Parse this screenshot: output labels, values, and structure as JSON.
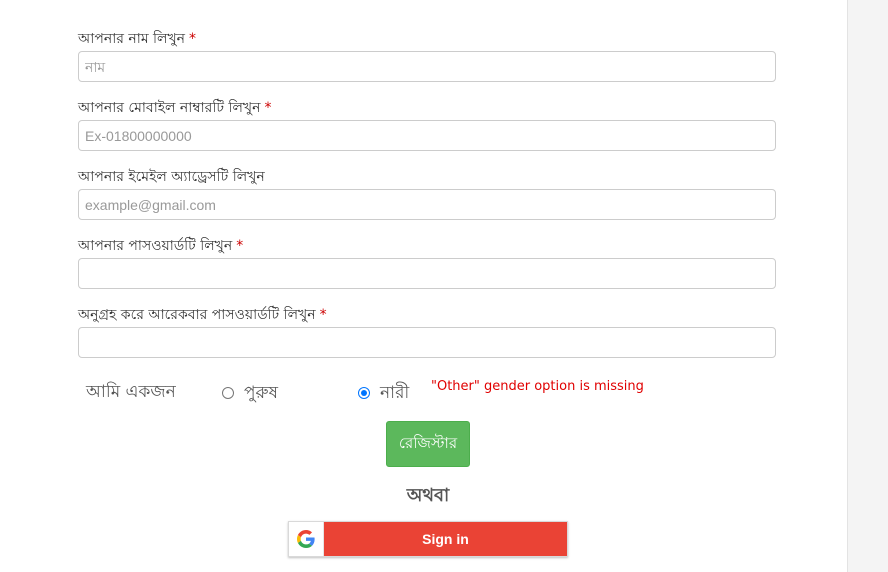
{
  "form": {
    "name": {
      "label": "আপনার নাম লিখুন",
      "required_mark": "*",
      "placeholder": "নাম",
      "value": ""
    },
    "mobile": {
      "label": "আপনার মোবাইল নাম্বারটি লিখুন",
      "required_mark": "*",
      "placeholder": "Ex-01800000000",
      "value": ""
    },
    "email": {
      "label": "আপনার ইমেইল অ্যাড্রেসটি লিখুন",
      "placeholder": "example@gmail.com",
      "value": ""
    },
    "password": {
      "label": "আপনার পাসওয়ার্ডটি লিখুন",
      "required_mark": "*",
      "placeholder": "",
      "value": ""
    },
    "confirm_password": {
      "label": "অনুগ্রহ করে আরেকবার পাসওয়ার্ডটি লিখুন",
      "required_mark": "*",
      "placeholder": "",
      "value": ""
    },
    "gender": {
      "label": "আমি একজন",
      "options": [
        {
          "label": "পুরুষ",
          "checked": false
        },
        {
          "label": "নারী",
          "checked": true
        }
      ]
    },
    "annotation": "\"Other\" gender option is missing",
    "register_label": "রেজিস্টার",
    "or_label": "অথবা",
    "google_signin_label": "Sign in"
  },
  "colors": {
    "register_button": "#5cb85c",
    "google_button": "#ea4335",
    "required_mark": "#cc0000",
    "annotation": "#e00000",
    "radio_accent": "#0075ff"
  },
  "icons": {
    "google": "google-g-logo-icon"
  }
}
